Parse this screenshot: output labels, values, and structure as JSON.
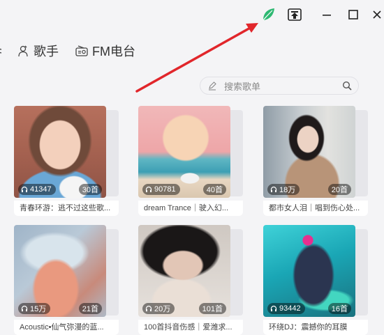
{
  "window": {
    "controls": [
      "leaf-icon",
      "pin-top-icon",
      "minimize-icon",
      "maximize-icon",
      "close-icon"
    ],
    "accent_color": "#2eb872",
    "annotation_arrow_color": "#e1262b"
  },
  "nav": {
    "partial_label": "",
    "singer_label": "歌手",
    "fm_label": "FM电台"
  },
  "search": {
    "placeholder": "搜索歌单",
    "value": ""
  },
  "playlists": [
    {
      "plays": "41347",
      "count": "30首",
      "title": "青春环游：逃不过这些歌..."
    },
    {
      "plays": "90781",
      "count": "40首",
      "title": "dream Trance｜驶入幻..."
    },
    {
      "plays": "18万",
      "count": "20首",
      "title": "都市女人泪｜唱到伤心处..."
    },
    {
      "plays": "15万",
      "count": "21首",
      "title": "Acoustic•仙气弥漫的蓝..."
    },
    {
      "plays": "20万",
      "count": "101首",
      "title": "100首抖音伤感｜爱潍求..."
    },
    {
      "plays": "93442",
      "count": "16首",
      "title": "环绕DJ：震撼你的耳膜"
    }
  ]
}
